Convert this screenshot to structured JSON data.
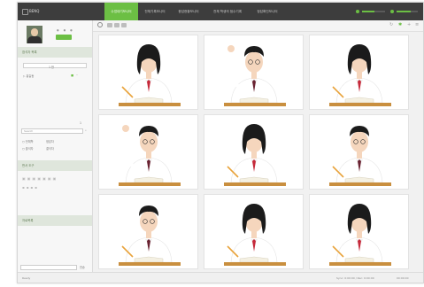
{
  "app": {
    "logo_text": "BENQ"
  },
  "topnav": {
    "tabs": [
      {
        "label": "수업대기모니터",
        "active": true
      },
      {
        "label": "전체기록모니터",
        "active": false
      },
      {
        "label": "응답현황모니터",
        "active": false
      },
      {
        "label": "전체 학생의 점수기록",
        "active": false
      },
      {
        "label": "정답확인모니터",
        "active": false
      }
    ],
    "sliders": [
      "volume-slider",
      "brightness-slider"
    ]
  },
  "sidebar": {
    "cam_dots": "● ● ●",
    "section1": "참석자 목록",
    "select_value": "1 반",
    "student_label": "홍길동",
    "page_count": "1",
    "search_label": "Search",
    "search_placeholder": "",
    "filters": [
      "전체학",
      "정답자",
      "출석자",
      "결석자"
    ],
    "section2": "판서 도구",
    "section3": "자료목록",
    "bottom_label": "전송"
  },
  "main": {
    "students": [
      {
        "id": 1,
        "gender": "girl",
        "pose": "write"
      },
      {
        "id": 2,
        "gender": "boy",
        "pose": "raise"
      },
      {
        "id": 3,
        "gender": "girl",
        "pose": "write"
      },
      {
        "id": 4,
        "gender": "boy",
        "pose": "raise"
      },
      {
        "id": 5,
        "gender": "girl",
        "pose": "write"
      },
      {
        "id": 6,
        "gender": "boy",
        "pose": "write"
      },
      {
        "id": 7,
        "gender": "boy",
        "pose": "write"
      },
      {
        "id": 8,
        "gender": "girl",
        "pose": "write"
      },
      {
        "id": 9,
        "gender": "girl",
        "pose": "write"
      }
    ]
  },
  "status": {
    "left": "Ready",
    "right": "Sync: 0:00:00 / Rec: 0:00:00",
    "time": "00:00:00"
  },
  "colors": {
    "accent": "#6cbf44",
    "topbar": "#3d3d3d",
    "skin": "#f5d6bd",
    "hair": "#1b1b1b",
    "shirt": "#ffffff",
    "tie_girl": "#c62a3b",
    "tie_boy": "#6a2332",
    "desk": "#c98f3f",
    "book": "#f4f0e2",
    "pencil": "#e8a23a"
  }
}
